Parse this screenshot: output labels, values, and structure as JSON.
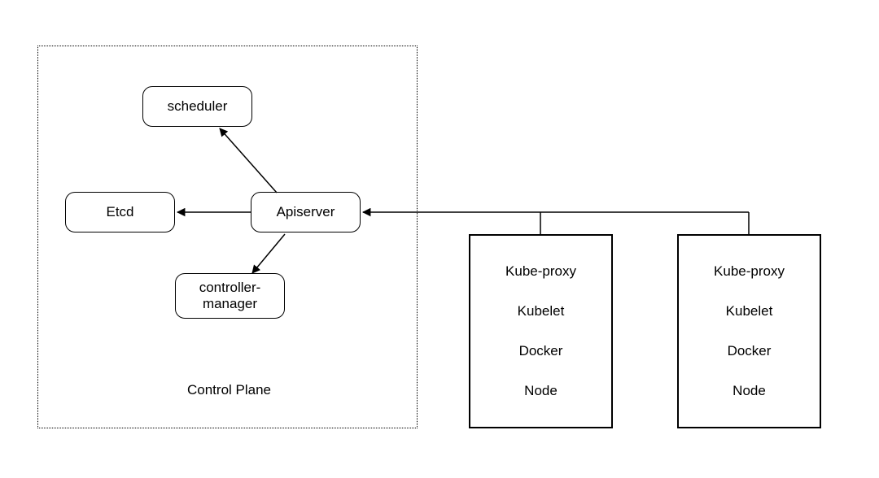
{
  "control_plane": {
    "label": "Control Plane",
    "components": {
      "scheduler": "scheduler",
      "etcd": "Etcd",
      "apiserver": "Apiserver",
      "controller_manager": "controller-\nmanager"
    }
  },
  "nodes": [
    {
      "items": [
        "Kube-proxy",
        "Kubelet",
        "Docker",
        "Node"
      ]
    },
    {
      "items": [
        "Kube-proxy",
        "Kubelet",
        "Docker",
        "Node"
      ]
    }
  ]
}
